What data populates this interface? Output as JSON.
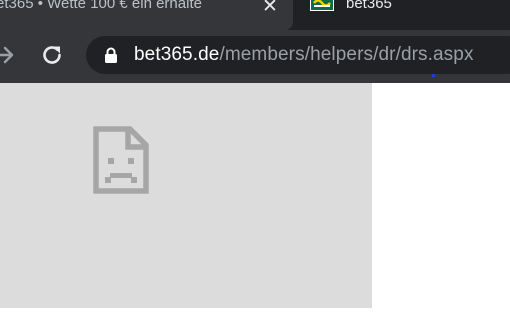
{
  "tabs": [
    {
      "title": "et365 • Wette 100 € ein erhalte",
      "active": true,
      "close_icon": "close-icon"
    },
    {
      "title": "bet365",
      "active": false,
      "favicon": "bet365-favicon"
    }
  ],
  "toolbar": {
    "forward_icon": "arrow-right-icon",
    "reload_icon": "reload-icon"
  },
  "omnibox": {
    "lock_icon": "lock-icon",
    "url_host": "bet365.de",
    "url_path": "/members/helpers/dr/drs.aspx"
  },
  "content": {
    "frame_icon": "sad-document-icon"
  },
  "colors": {
    "tabstrip": "#202124",
    "toolbar": "#35363a",
    "omnibox": "#202124",
    "frame_bg": "#dcdcdc",
    "broken_icon": "#a6a6a6"
  }
}
